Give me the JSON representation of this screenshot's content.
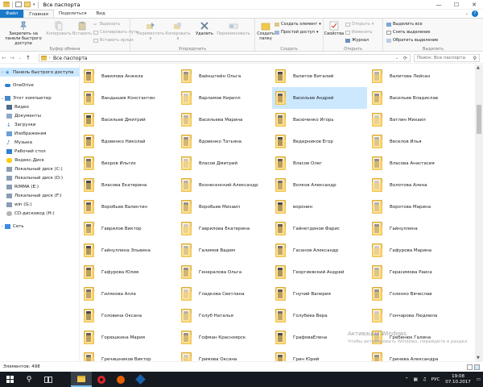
{
  "window": {
    "title": "Все паспорта",
    "controls": [
      "—",
      "☐",
      "✕"
    ]
  },
  "ribbon_tabs": [
    "Файл",
    "Главная",
    "Поделиться",
    "Вид"
  ],
  "ribbon": {
    "clipboard": {
      "pin_label": "Закрепить на панели быстрого доступа",
      "copy_label": "Копировать",
      "paste_label": "Вставить",
      "cut_label": "Вырезать",
      "copy_path_label": "Скопировать путь",
      "paste_shortcut_label": "Вставить ярлык",
      "group_label": "Буфер обмена"
    },
    "organize": {
      "move_label": "Переместить в",
      "copy_to_label": "Копировать в",
      "delete_label": "Удалить",
      "rename_label": "Переименовать",
      "group_label": "Упорядочить"
    },
    "new": {
      "new_folder_label": "Создать папку",
      "new_item_label": "Создать элемент",
      "easy_access_label": "Простой доступ",
      "group_label": "Создать"
    },
    "open": {
      "properties_label": "Свойства",
      "open_label": "Открыть",
      "edit_label": "Изменить",
      "history_label": "Журнал",
      "group_label": "Открыть"
    },
    "select": {
      "select_all_label": "Выделить все",
      "select_none_label": "Снять выделение",
      "invert_label": "Обратить выделение",
      "group_label": "Выделить"
    }
  },
  "address": {
    "path": "Все паспорта",
    "search_placeholder": "Поиск: Все паспорта"
  },
  "nav": [
    {
      "label": "Панель быстрого доступа",
      "icon": "star-icon",
      "selected": true
    },
    {
      "label": "OneDrive",
      "icon": "cloud-icon"
    },
    {
      "label": "Этот компьютер",
      "icon": "computer-icon"
    },
    {
      "label": "Видео",
      "icon": "video-icon"
    },
    {
      "label": "Документы",
      "icon": "documents-icon"
    },
    {
      "label": "Загрузки",
      "icon": "downloads-icon"
    },
    {
      "label": "Изображения",
      "icon": "pictures-icon"
    },
    {
      "label": "Музыка",
      "icon": "music-icon"
    },
    {
      "label": "Рабочий стол",
      "icon": "desktop-icon"
    },
    {
      "label": "Яндекс.Диск",
      "icon": "yandex-disk-icon"
    },
    {
      "label": "Локальный диск (C:)",
      "icon": "drive-icon"
    },
    {
      "label": "Локальный диск (D:)",
      "icon": "drive-icon"
    },
    {
      "label": "RIMMA (E:)",
      "icon": "drive-icon"
    },
    {
      "label": "Локальный диск (F:)",
      "icon": "drive-icon"
    },
    {
      "label": "win (G:)",
      "icon": "drive-icon"
    },
    {
      "label": "CD-дисковод (H:)",
      "icon": "cd-drive-icon"
    },
    {
      "label": "Сеть",
      "icon": "network-icon"
    }
  ],
  "folders": [
    [
      "Вавилова Анжела",
      "Вайнштейн Ольга",
      "Валитов Виталий",
      "Валитова Лейсан"
    ],
    [
      "Вандышев Константин",
      "Варламов Кирилл",
      "Васильев Андрей",
      "Васильев Владислав"
    ],
    [
      "Васильев Дмитрий",
      "Васильева Марина",
      "Васюченко Игорь",
      "Ватлин Михаил"
    ],
    [
      "Вдовенко Николай",
      "Вдовенко Татьяна",
      "Ведерников Егор",
      "Веселов Илья"
    ],
    [
      "Вихров Ильгиз",
      "Власов Дмитрий",
      "Власов Олег",
      "Власова Анастасия"
    ],
    [
      "Власова Екатерина",
      "Вознесенский Александр",
      "Волков Александр",
      "Волотова Алена"
    ],
    [
      "Воробьев Валентин",
      "Воробьев Михаил",
      "воронин",
      "Воротова Марина"
    ],
    [
      "Гаврилов Виктор",
      "Гаврилова Екатерина",
      "Гайнетдинов Фарис",
      "Гайнуллина"
    ],
    [
      "Гайнуллина Эльвина",
      "Галимов Вадим",
      "Гасанов Александр",
      "Гафурова Марина"
    ],
    [
      "Гафурова Юлия",
      "Генералова Ольга",
      "Георгиевский Андрей",
      "Герасимова Раиса"
    ],
    [
      "Гиляхова Алла",
      "Гладкова Светлана",
      "Гнучий Валерия",
      "Голенко Вячеслав"
    ],
    [
      "Головина Оксана",
      "Голуб Наталья",
      "Голубева Вера",
      "Гончарова Людмила"
    ],
    [
      "Горюшкина Мария",
      "Гофман Красноярск",
      "ГрафоваЕлена",
      "Гребенюк Галина"
    ],
    [
      "Гречишников Виктор",
      "Гримова Оксана",
      "Грин Юрий",
      "Гринева Александра"
    ]
  ],
  "selected_folder": "Васильев Андрей",
  "status": {
    "count": "Элементов: 498"
  },
  "watermark": {
    "line1": "Активация Windows",
    "line2": "Чтобы активировать Windows, перейдите в раздел"
  },
  "taskbar": {
    "lang": "РУС",
    "time": "19:08",
    "date": "07.10.2017"
  },
  "colors": {
    "accent": "#1979ca",
    "selection": "#cce8ff",
    "folder": "#f6d67a",
    "taskbar": "#151a21"
  }
}
